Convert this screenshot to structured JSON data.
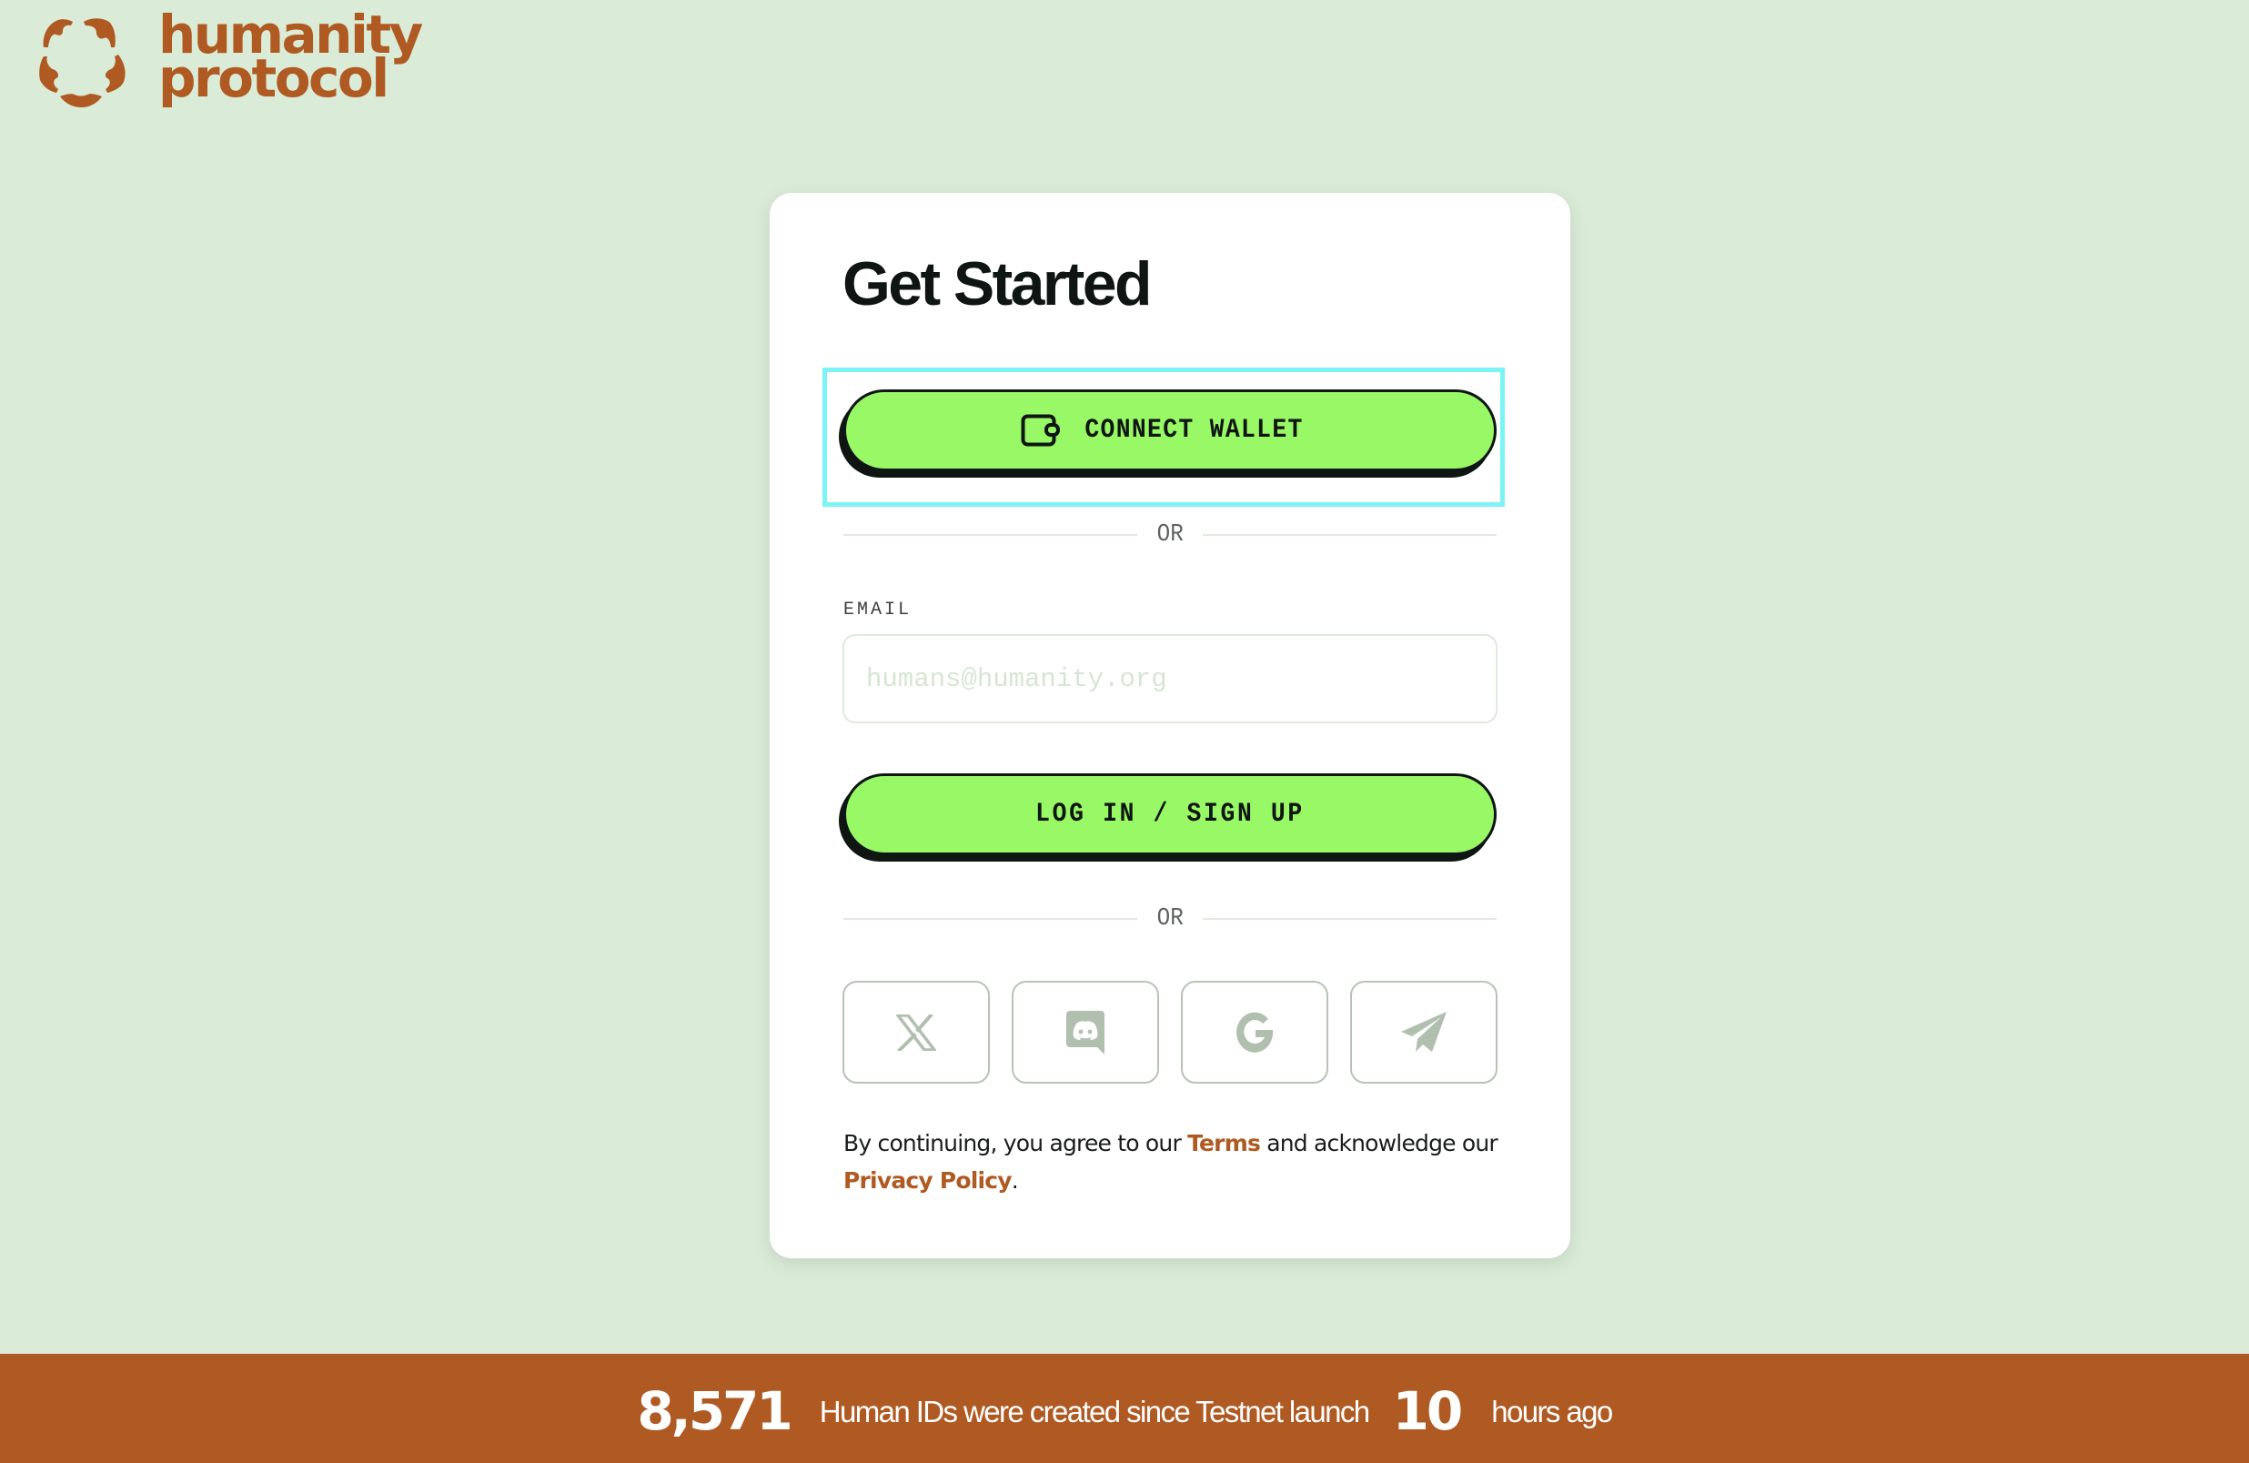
{
  "brand": {
    "name_line1": "humanity",
    "name_line2": "protocol",
    "color": "#af5a22",
    "logo_icon": "humanity-logo-icon"
  },
  "card": {
    "title": "Get Started",
    "connect_wallet": {
      "label": "CONNECT WALLET",
      "icon": "wallet-icon",
      "focused": true
    },
    "divider_text": "OR",
    "email": {
      "label": "EMAIL",
      "placeholder": "humans@humanity.org",
      "value": ""
    },
    "login_button": {
      "label": "LOG IN / SIGN UP"
    },
    "social_logins": [
      {
        "name": "x",
        "icon": "x-twitter-icon"
      },
      {
        "name": "discord",
        "icon": "discord-icon"
      },
      {
        "name": "google",
        "icon": "google-icon"
      },
      {
        "name": "telegram",
        "icon": "telegram-icon"
      }
    ],
    "terms": {
      "prefix": "By continuing, you agree to our ",
      "terms_link": "Terms",
      "middle": " and acknowledge our ",
      "privacy_link": "Privacy Policy",
      "suffix": "."
    }
  },
  "banner": {
    "count": "8,571",
    "description": "Human IDs were created since Testnet launch",
    "hours": "10",
    "suffix": "hours ago"
  },
  "colors": {
    "background": "#daebd7",
    "accent_green": "#98f866",
    "brand_orange": "#af5a22",
    "focus_ring": "#7cf4f6",
    "social_icon": "#b0bfae"
  }
}
